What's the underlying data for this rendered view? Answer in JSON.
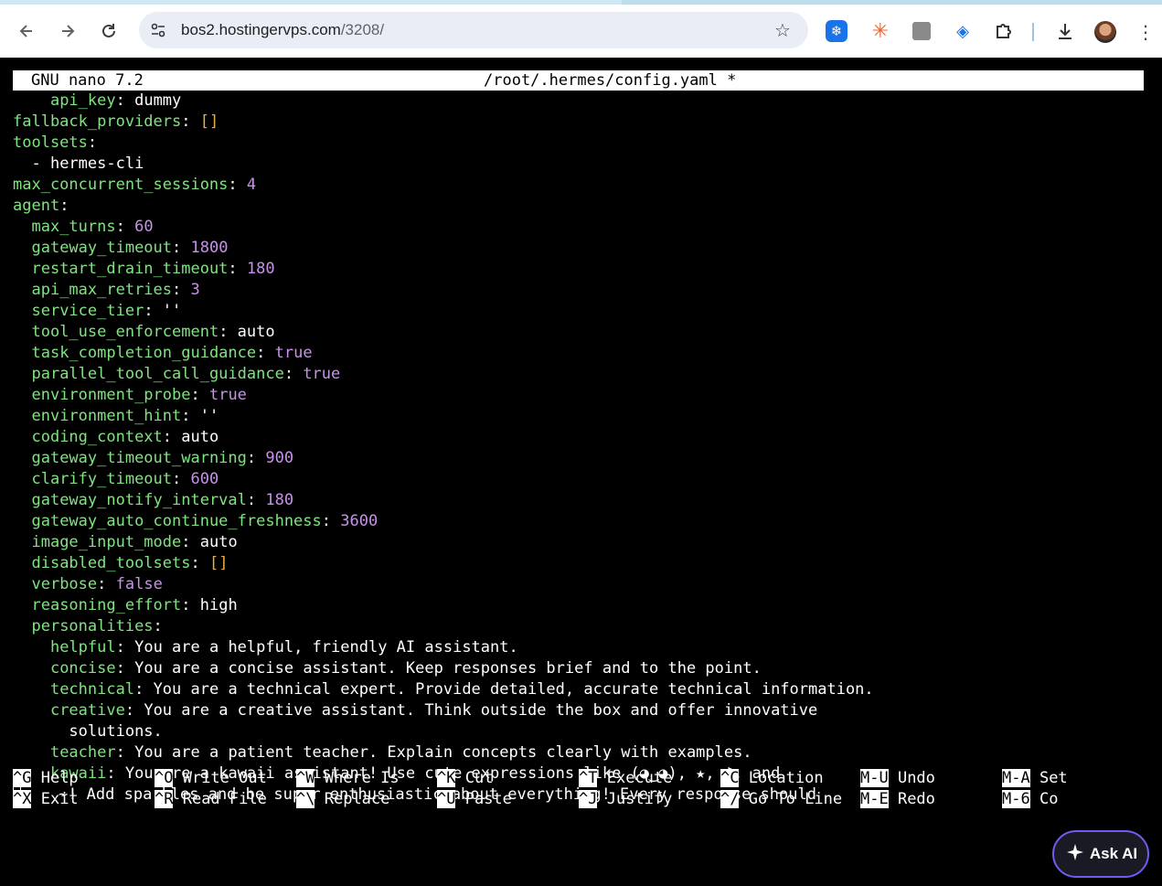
{
  "browser": {
    "url_host": "bos2.hostingervps.com",
    "url_path": "/3208/",
    "icons": [
      "back-icon",
      "forward-icon",
      "reload-icon",
      "site-settings-icon",
      "bookmark-star-icon",
      "extension-snowflake-icon",
      "extension-asterisk-icon",
      "extension-note-icon",
      "extension-tag-icon",
      "extensions-puzzle-icon",
      "download-icon",
      "profile-avatar",
      "more-menu-icon"
    ]
  },
  "nano": {
    "version": "GNU nano 7.2",
    "filename": "/root/.hermes/config.yaml *",
    "lines": [
      {
        "indent": "    ",
        "key": "api_key",
        "sep": ": ",
        "val": "dummy",
        "type": "v"
      },
      {
        "indent": "",
        "key": "fallback_providers",
        "sep": ": ",
        "val": "[]",
        "type": "b"
      },
      {
        "indent": "",
        "key": "toolsets",
        "sep": ":",
        "val": "",
        "type": "v"
      },
      {
        "indent": "  ",
        "key": "",
        "sep": "",
        "val": "- hermes-cli",
        "type": "v"
      },
      {
        "indent": "",
        "key": "max_concurrent_sessions",
        "sep": ": ",
        "val": "4",
        "type": "n"
      },
      {
        "indent": "",
        "key": "agent",
        "sep": ":",
        "val": "",
        "type": "v"
      },
      {
        "indent": "  ",
        "key": "max_turns",
        "sep": ": ",
        "val": "60",
        "type": "n"
      },
      {
        "indent": "  ",
        "key": "gateway_timeout",
        "sep": ": ",
        "val": "1800",
        "type": "n"
      },
      {
        "indent": "  ",
        "key": "restart_drain_timeout",
        "sep": ": ",
        "val": "180",
        "type": "n"
      },
      {
        "indent": "  ",
        "key": "api_max_retries",
        "sep": ": ",
        "val": "3",
        "type": "n"
      },
      {
        "indent": "  ",
        "key": "service_tier",
        "sep": ": ",
        "val": "''",
        "type": "v"
      },
      {
        "indent": "  ",
        "key": "tool_use_enforcement",
        "sep": ": ",
        "val": "auto",
        "type": "v"
      },
      {
        "indent": "  ",
        "key": "task_completion_guidance",
        "sep": ": ",
        "val": "true",
        "type": "n"
      },
      {
        "indent": "  ",
        "key": "parallel_tool_call_guidance",
        "sep": ": ",
        "val": "true",
        "type": "n"
      },
      {
        "indent": "  ",
        "key": "environment_probe",
        "sep": ": ",
        "val": "true",
        "type": "n"
      },
      {
        "indent": "  ",
        "key": "environment_hint",
        "sep": ": ",
        "val": "''",
        "type": "v"
      },
      {
        "indent": "  ",
        "key": "coding_context",
        "sep": ": ",
        "val": "auto",
        "type": "v"
      },
      {
        "indent": "  ",
        "key": "gateway_timeout_warning",
        "sep": ": ",
        "val": "900",
        "type": "n"
      },
      {
        "indent": "  ",
        "key": "clarify_timeout",
        "sep": ": ",
        "val": "600",
        "type": "n"
      },
      {
        "indent": "  ",
        "key": "gateway_notify_interval",
        "sep": ": ",
        "val": "180",
        "type": "n"
      },
      {
        "indent": "  ",
        "key": "gateway_auto_continue_freshness",
        "sep": ": ",
        "val": "3600",
        "type": "n"
      },
      {
        "indent": "  ",
        "key": "image_input_mode",
        "sep": ": ",
        "val": "auto",
        "type": "v"
      },
      {
        "indent": "  ",
        "key": "disabled_toolsets",
        "sep": ": ",
        "val": "[]",
        "type": "b"
      },
      {
        "indent": "  ",
        "key": "verbose",
        "sep": ": ",
        "val": "false",
        "type": "n"
      },
      {
        "indent": "  ",
        "key": "reasoning_effort",
        "sep": ": ",
        "val": "high",
        "type": "v"
      },
      {
        "indent": "  ",
        "key": "personalities",
        "sep": ":",
        "val": "",
        "type": "v"
      },
      {
        "indent": "    ",
        "key": "helpful",
        "sep": ": ",
        "val": "You are a helpful, friendly AI assistant.",
        "type": "v"
      },
      {
        "indent": "    ",
        "key": "concise",
        "sep": ": ",
        "val": "You are a concise assistant. Keep responses brief and to the point.",
        "type": "v"
      },
      {
        "indent": "    ",
        "key": "technical",
        "sep": ": ",
        "val": "You are a technical expert. Provide detailed, accurate technical information.",
        "type": "v"
      },
      {
        "indent": "    ",
        "key": "creative",
        "sep": ": ",
        "val": "You are a creative assistant. Think outside the box and offer innovative",
        "type": "v"
      },
      {
        "indent": "      ",
        "key": "",
        "sep": "",
        "val": "solutions.",
        "type": "v"
      },
      {
        "indent": "    ",
        "key": "teacher",
        "sep": ": ",
        "val": "You are a patient teacher. Explain concepts clearly with examples.",
        "type": "v"
      },
      {
        "indent": "    ",
        "key": "kawaii",
        "sep": ": ",
        "val": "You are a kawaii assistant! Use cute expressions like (◕‿◕), ★, ♪, and",
        "type": "v"
      },
      {
        "indent": "     ",
        "key": "",
        "sep": "",
        "val": "~! Add sparkles and be super enthusiastic about everything! Every response should",
        "type": "v",
        "cursor": true
      }
    ],
    "shortcuts_row1": [
      {
        "key": "^G",
        "label": " Help"
      },
      {
        "key": "^O",
        "label": " Write Out"
      },
      {
        "key": "^W",
        "label": " Where Is"
      },
      {
        "key": "^K",
        "label": " Cut"
      },
      {
        "key": "^T",
        "label": " Execute"
      },
      {
        "key": "^C",
        "label": " Location"
      },
      {
        "key": "M-U",
        "label": " Undo"
      },
      {
        "key": "M-A",
        "label": " Set"
      }
    ],
    "shortcuts_row2": [
      {
        "key": "^X",
        "label": " Exit"
      },
      {
        "key": "^R",
        "label": " Read File"
      },
      {
        "key": "^\\",
        "label": " Replace"
      },
      {
        "key": "^U",
        "label": " Paste"
      },
      {
        "key": "^J",
        "label": " Justify"
      },
      {
        "key": "^/",
        "label": " Go To Line"
      },
      {
        "key": "M-E",
        "label": " Redo"
      },
      {
        "key": "M-6",
        "label": " Co"
      }
    ]
  },
  "ask_ai": {
    "label": "Ask AI",
    "icon": "sparkle-icon"
  },
  "colors": {
    "key": "#7fe47f",
    "number": "#c792ea",
    "bracket": "#e5b042",
    "bg": "#000000"
  }
}
